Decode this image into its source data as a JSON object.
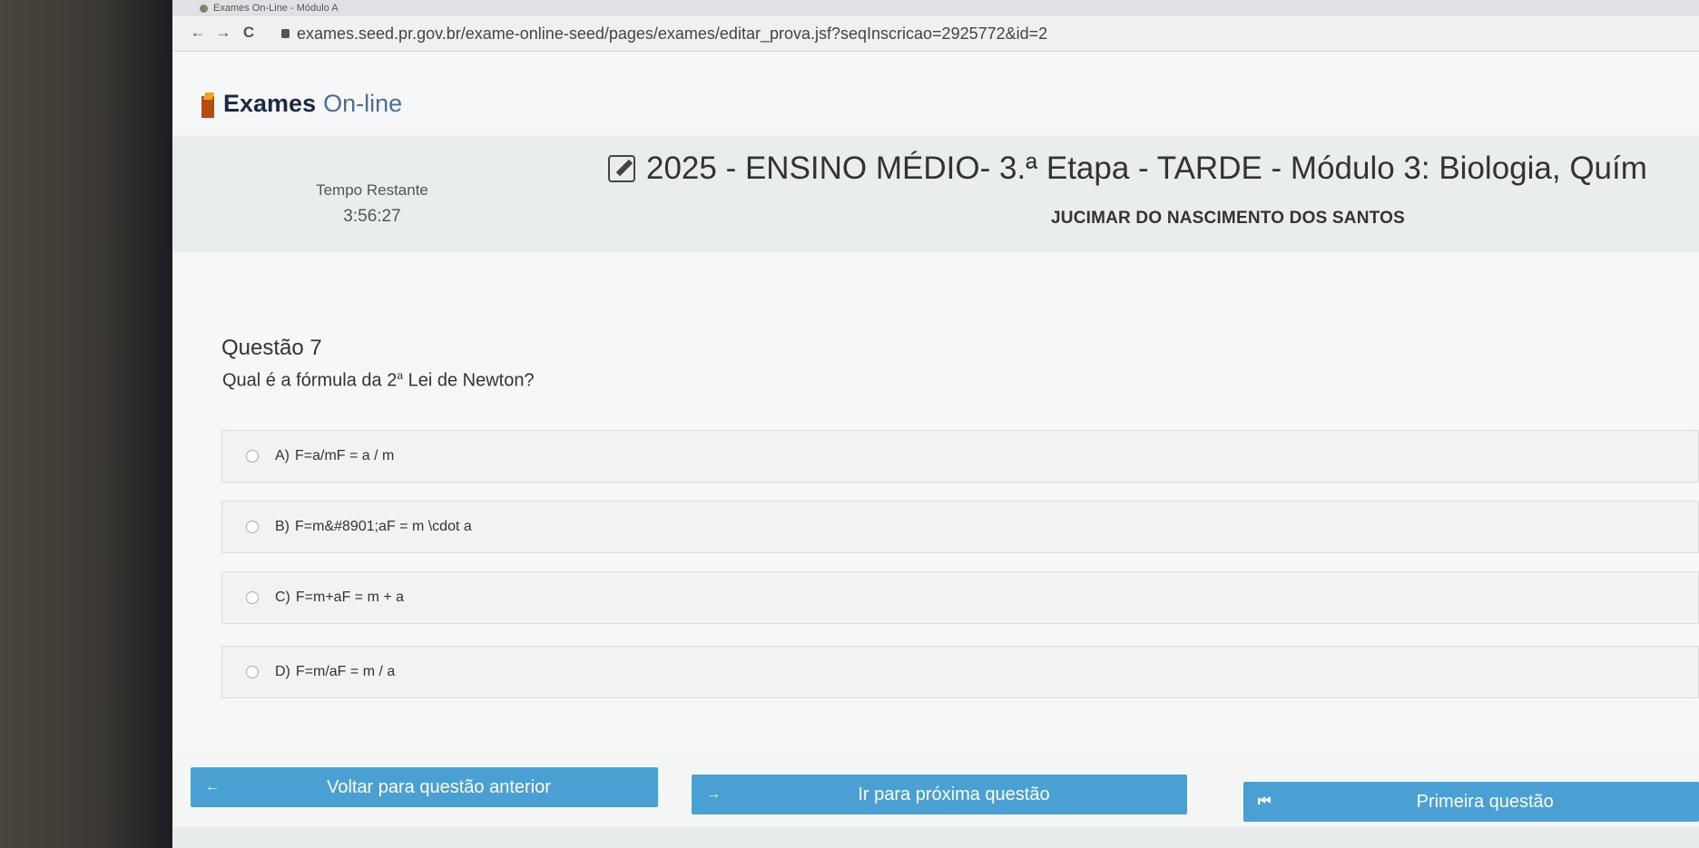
{
  "browser": {
    "tab_title": "Exames On-Line - Módulo A",
    "url": "exames.seed.pr.gov.br/exame-online-seed/pages/exames/editar_prova.jsf?seqInscricao=2925772&id=2",
    "back_icon": "←",
    "forward_icon": "→",
    "reload_icon": "C"
  },
  "header": {
    "logo_strong": "Exames",
    "logo_light": "On-line"
  },
  "exam": {
    "timer_label": "Tempo Restante",
    "timer_value": "3:56:27",
    "title": "2025 - ENSINO MÉDIO- 3.ª Etapa - TARDE - Módulo 3: Biologia, Quím",
    "student_name": "JUCIMAR DO NASCIMENTO DOS SANTOS"
  },
  "question": {
    "title": "Questão 7",
    "text_before": "Qual é a fórmula da 2",
    "text_sup": "a",
    "text_after": " Lei de Newton?",
    "options": [
      {
        "letter": "A)",
        "text": "F=a/mF = a / m"
      },
      {
        "letter": "B)",
        "text": "F=m&#8901;aF = m \\cdot a"
      },
      {
        "letter": "C)",
        "text": "F=m+aF = m + a"
      },
      {
        "letter": "D)",
        "text": "F=m/aF = m / a"
      }
    ]
  },
  "navigation": {
    "prev_label": "Voltar para questão anterior",
    "prev_icon": "←",
    "next_label": "Ir para próxima questão",
    "next_icon": "→",
    "first_label": "Primeira questão",
    "first_icon": "⏮"
  },
  "colors": {
    "button_blue": "#4aa0d2",
    "logo_orange": "#b54b14",
    "logo_dark": "#1a2a44"
  }
}
